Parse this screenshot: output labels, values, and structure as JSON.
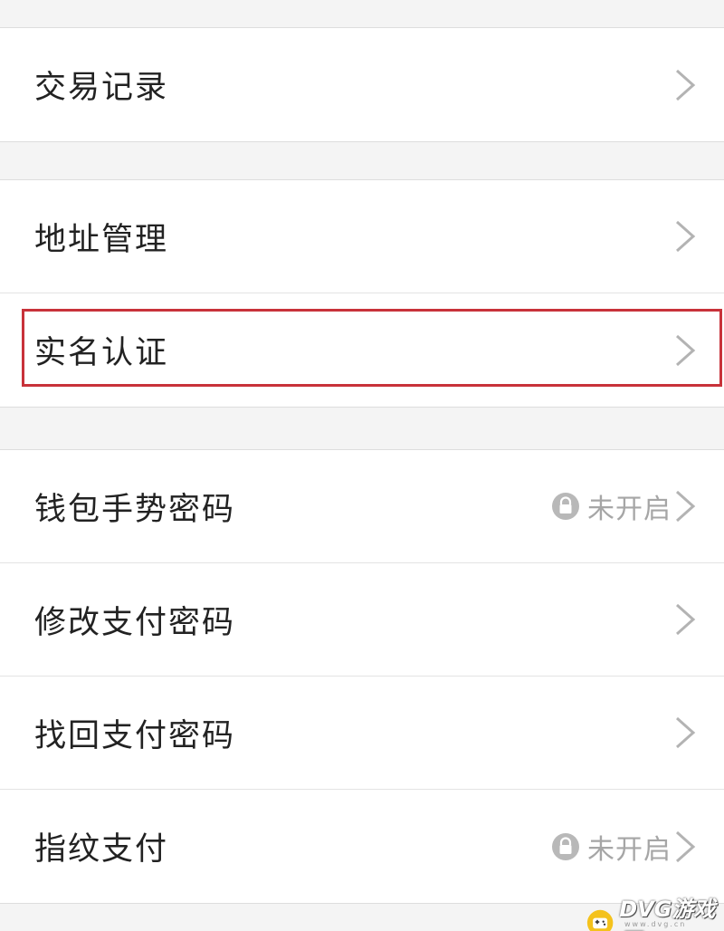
{
  "groups": [
    {
      "items": [
        {
          "label": "交易记录"
        }
      ]
    },
    {
      "items": [
        {
          "label": "地址管理"
        },
        {
          "label": "实名认证"
        }
      ]
    },
    {
      "items": [
        {
          "label": "钱包手势密码",
          "status": "未开启"
        },
        {
          "label": "修改支付密码"
        },
        {
          "label": "找回支付密码"
        },
        {
          "label": "指纹支付",
          "status": "未开启"
        }
      ]
    }
  ],
  "icons": {
    "chevron": "chevron-right-icon",
    "lock": "lock-icon",
    "watermark_logo": "game-controller-icon"
  },
  "colors": {
    "highlight": "#c8323a",
    "status_text": "#a6a6a6",
    "label_text": "#222222"
  },
  "watermark": {
    "text": "DVG游戏网",
    "sub": "www.dvg.cn"
  }
}
